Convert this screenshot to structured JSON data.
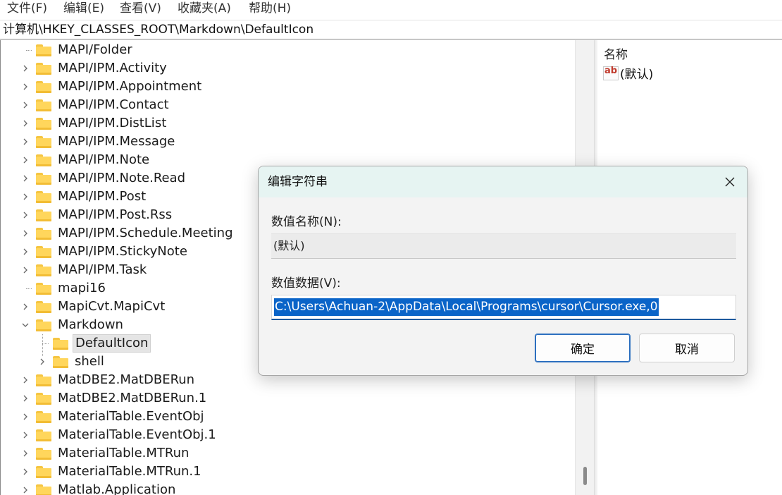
{
  "menu": [
    "文件(F)",
    "编辑(E)",
    "查看(V)",
    "收藏夹(A)",
    "帮助(H)"
  ],
  "address": "计算机\\HKEY_CLASSES_ROOT\\Markdown\\DefaultIcon",
  "tree": [
    {
      "label": "MAPI/Folder",
      "expander": "none",
      "level": 0
    },
    {
      "label": "MAPI/IPM.Activity",
      "expander": "collapsed",
      "level": 0
    },
    {
      "label": "MAPI/IPM.Appointment",
      "expander": "collapsed",
      "level": 0
    },
    {
      "label": "MAPI/IPM.Contact",
      "expander": "collapsed",
      "level": 0
    },
    {
      "label": "MAPI/IPM.DistList",
      "expander": "collapsed",
      "level": 0
    },
    {
      "label": "MAPI/IPM.Message",
      "expander": "collapsed",
      "level": 0
    },
    {
      "label": "MAPI/IPM.Note",
      "expander": "collapsed",
      "level": 0
    },
    {
      "label": "MAPI/IPM.Note.Read",
      "expander": "collapsed",
      "level": 0
    },
    {
      "label": "MAPI/IPM.Post",
      "expander": "collapsed",
      "level": 0
    },
    {
      "label": "MAPI/IPM.Post.Rss",
      "expander": "collapsed",
      "level": 0
    },
    {
      "label": "MAPI/IPM.Schedule.Meeting",
      "expander": "collapsed",
      "level": 0
    },
    {
      "label": "MAPI/IPM.StickyNote",
      "expander": "collapsed",
      "level": 0
    },
    {
      "label": "MAPI/IPM.Task",
      "expander": "collapsed",
      "level": 0
    },
    {
      "label": "mapi16",
      "expander": "none",
      "level": 0
    },
    {
      "label": "MapiCvt.MapiCvt",
      "expander": "collapsed",
      "level": 0
    },
    {
      "label": "Markdown",
      "expander": "expanded",
      "level": 0
    },
    {
      "label": "DefaultIcon",
      "expander": "none",
      "level": 1,
      "selected": true
    },
    {
      "label": "shell",
      "expander": "collapsed",
      "level": 1
    },
    {
      "label": "MatDBE2.MatDBERun",
      "expander": "collapsed",
      "level": 0
    },
    {
      "label": "MatDBE2.MatDBERun.1",
      "expander": "collapsed",
      "level": 0
    },
    {
      "label": "MaterialTable.EventObj",
      "expander": "collapsed",
      "level": 0
    },
    {
      "label": "MaterialTable.EventObj.1",
      "expander": "collapsed",
      "level": 0
    },
    {
      "label": "MaterialTable.MTRun",
      "expander": "collapsed",
      "level": 0
    },
    {
      "label": "MaterialTable.MTRun.1",
      "expander": "collapsed",
      "level": 0
    },
    {
      "label": "Matlab.Application",
      "expander": "collapsed",
      "level": 0
    }
  ],
  "list": {
    "header_name": "名称",
    "items": [
      {
        "name": "(默认)",
        "icon": "string-value-icon"
      }
    ]
  },
  "dialog": {
    "title": "编辑字符串",
    "name_label": "数值名称(N):",
    "name_value": "(默认)",
    "data_label": "数值数据(V):",
    "data_value": "C:\\Users\\Achuan-2\\AppData\\Local\\Programs\\cursor\\Cursor.exe,0",
    "ok_label": "确定",
    "cancel_label": "取消"
  }
}
